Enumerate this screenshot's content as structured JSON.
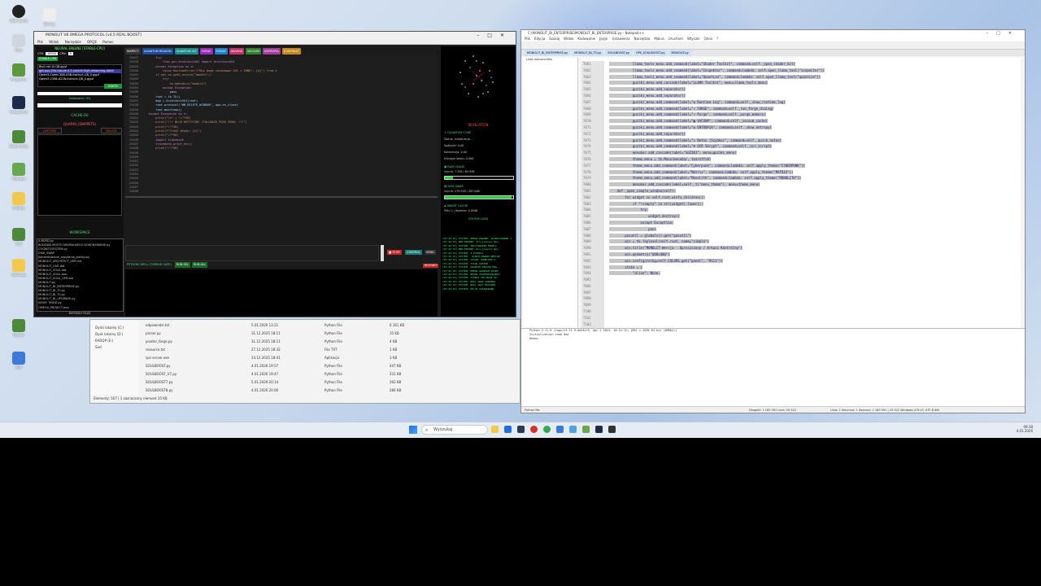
{
  "desktop": {
    "icons": [
      {
        "label": "OBS Studio"
      },
      {
        "label": "Ekrany"
      },
      {
        "label": "Kosz"
      },
      {
        "label": "Programy"
      },
      {
        "label": "Ustawienia"
      },
      {
        "label": "Dokumenty"
      },
      {
        "label": "Pobrane"
      },
      {
        "label": "Foldery"
      },
      {
        "label": "Sieć"
      },
      {
        "label": "Aplikacja"
      },
      {
        "label": "Python"
      },
      {
        "label": "Pliki"
      }
    ]
  },
  "explorer": {
    "nav": [
      "Dyski lokalny (C:)",
      "Dysk lokalny (D:)",
      "RADQP (E:)",
      "Sieć"
    ],
    "rows": [
      {
        "name": "odpowiedzi.txt",
        "date": "5.01.2026 13:21",
        "type": "Python File",
        "size": "6 161 KB"
      },
      {
        "name": "parser.py",
        "date": "31.12.2025 18:11",
        "type": "Python File",
        "size": "35 KB"
      },
      {
        "name": "pivator_forge.py",
        "date": "31.12.2025 18:11",
        "type": "Python File",
        "size": "4 KB"
      },
      {
        "name": "resource.txt",
        "date": "27.12.2025 18:32",
        "type": "File TXT",
        "size": "1 KB"
      },
      {
        "name": "spc-server.exe",
        "date": "14.12.2025 18:41",
        "type": "Aplikacja",
        "size": "3 KB"
      },
      {
        "name": "SOULBOOST.py",
        "date": "4.01.2026 19:57",
        "type": "Python File",
        "size": "447 KB"
      },
      {
        "name": "SOULBOOST_V7.py",
        "date": "4.01.2026 19:47",
        "type": "Python File",
        "size": "231 KB"
      },
      {
        "name": "SOULBOOST7.py",
        "date": "5.01.2026 20:14",
        "type": "Python File",
        "size": "262 KB"
      },
      {
        "name": "SOULBOOST8.py",
        "date": "4.01.2026 20:00",
        "type": "Python File",
        "size": "286 KB"
      }
    ],
    "status": "Elementy: 167 | 1 zaznaczony element 35 KB"
  },
  "app": {
    "title": "MONOLIT V8 OMEGA PROTOCOL [v4.5 REAL BOOST]",
    "menu": [
      "Plik",
      "Widok",
      "Narzędzia",
      "OPCJE",
      "Pomoc"
    ],
    "left": {
      "header": "NEURAL ENGINE [STABLE-CPU]",
      "ctx_label": "CTX:",
      "ctx_value": "16000",
      "cpu_label": "CPU:",
      "cpu_value": "8",
      "stable_btn": "STABLE CPU",
      "model_list": [
        "Bio2-vm-llr-Q8.gguf",
        "gpt-oss-20b-claude-4.5-sonnet-high-reasoning-distill",
        "Qwen3-Coder-30B-A3B-Instruct-Q8_0.gguf",
        "Qwen3-235B-A22B-Instruct-Q8_0.gguf"
      ],
      "ignite_btn": "IGNITE",
      "loaded_label": "Ładowanie: 0%",
      "cache_label": "CACHE.OU",
      "quarks_label": "QUARKS (SNIPPETS)",
      "capture_btn": "CAPTURE",
      "delete_btn": "DELETE",
      "workspace_label": "WORKSPACE",
      "files": [
        "A.BORD.py",
        "BUDOWA MOSTU NEURALNEGO DOKONYWANIE.py",
        "COGNITOSYSTEM.py",
        "DISK_SWAP",
        "Komentowanie_zapytania_jezdny.py",
        "MONOLIT_ARCHITECT_VER.md",
        "MONOLIT_LIVE.dat",
        "MONOLIT_SOUL.dat",
        "MONOLIT_SOUL.json",
        "MONOLIT_SOUL_VER.dat",
        "MONOLIT.py",
        "MONOLIT_BI_ENTERPRISE.py",
        "MONOLIT_BI_T0.py",
        "MONOLIT_BI_T0.py",
        "MONOLIT_BI_UPGRADE.py",
        "NOWY TEMAT.py",
        "OMEGA_PROJECT.json",
        "OPS_SOULBOOST.py"
      ],
      "refresh_btn": "REFRESH FILES"
    },
    "toolbar": [
      "INSPECT",
      "QUANTUM REASON",
      "QUANTUM VIZ",
      "PURGE",
      "FORGE",
      "AKASHA",
      "VACUUM",
      "ENTROPIA",
      "CONTRAST"
    ],
    "toolbar_colors": [
      "#333333",
      "#1c4a9b",
      "#1a8a8a",
      "#9b2cbf",
      "#1b7fc9",
      "#c0336e",
      "#2f7f2f",
      "#a33d9b",
      "#c08a1a"
    ],
    "editor": {
      "line_numbers": [
        "25427",
        "25428",
        "25429",
        "25430",
        "25431",
        "25432",
        "25433",
        "25434",
        "25435",
        "25436",
        "25437",
        "25438",
        "25439",
        "25440",
        "25441",
        "25442",
        "25443",
        "25444",
        "25445",
        "25446",
        "25447",
        "25448",
        "25449",
        "25450",
        "25451",
        "25452",
        "25453",
        "25454",
        "25455",
        "25456",
        "25457",
        "25458"
      ],
      "lines": [
        "",
        "        try:",
        "            from gui.ArchitectGUI import ArchitectGUI",
        "        except Exception as e:",
        "            raise RuntimeError(f\"Nie mogę załadować GUI z INNE/: {e}\") from e",
        "",
        "        if not os.path.exists(\"models\"):",
        "            try:",
        "                os.makedirs(\"models\")",
        "            except Exception:",
        "                pass",
        "",
        "        root = tk.Tk()",
        "        app = ArchitectGUI(root)",
        "        root.protocol(\"WM_DELETE_WINDOW\", app.on_close)",
        "        root.mainloop()",
        "    except Exception as e:",
        "        print(\"\\n\" + \"=\"*50)",
        "        print(\"!!! BŁĄD KRYTYCZNY (FALLBACK POZA VENV) !!!\")",
        "        print(\"=\"*50)",
        "        print(f\"Treść błędu: {e}\")",
        "        print(\"=\"*50)",
        "        import traceback",
        "        traceback.print_exc()",
        "        print(\"=\"*50)",
        "",
        "",
        "",
        "",
        "",
        "",
        ""
      ]
    },
    "stop_btn": "STOP",
    "control_btn": "CONTROL",
    "send_btn": "SEND",
    "restart_btn": "RESTART",
    "shell": [
      "PYTHON SHELL (THREAD SAFE)",
      "RUN SEL",
      "RUN ALL"
    ],
    "right": {
      "revelation": "REVELATION",
      "quantum_core": "QUANTUM CORE",
      "status": "Status: Inicjalizacja...",
      "spojnosc": "Spójność: 0.00",
      "koherencja": "Koherencja: 0.00",
      "entropia": "Entropia lokalu: 0.000",
      "ram_label": "RAM USAGE",
      "ram_text": "Użycie: 7.35B / 63.93B",
      "ram_fill": 0.12,
      "disk_label": "DISK SWAP",
      "disk_text": "Użycie: 279.91B / 287.00B",
      "disk_fill": 0.975,
      "cache_label": "SMART CACHE",
      "cache_text": "Pliki: 1 | Rozmiar: 0.094B",
      "log_title": "SYSTEM LOGS",
      "log": [
        "[07:42:33] SYSTEM: OMEGA ENGINE: ZAINICJOWANO 1",
        "[07:42:33] NEW ENGINE: Inicjowanie Neu",
        "[07:42:33] SYSTEM: INICJOWANIE MODELI",
        "[07:42:33] NEW ENGINE: Inicjowanie Neu",
        "[07:42:33] SYSTEM: 2 PYSPELL",
        "[07:42:33] SYSTEM: 'ZAINICJOWANO WERTUA'",
        "[07:42:33] SYSTEM: VISUAL KAMELEON V.",
        "[07:42:33] SYSTEM: TYTUŁ DOKTOR",
        "[07:42:33] SYSTEM: QUANTUM REASON ENG",
        "[07:42:33] SYSTEM: OMEGA QUANTUM ZAINI",
        "[07:42:33] SYSTEM: BUDOA ZINTERESOWANIA",
        "[07:42:33] SYSTEM: STABLE CPU MODE ZA",
        "[07:42:33] SYSTEM: REAL SWAP ZAWIERA",
        "[07:42:33] SYSTEM: REAL GOLF BUILDER",
        "[07:42:33] SYSTEM: OPCJE ZAŁADOWANE"
      ]
    }
  },
  "npp": {
    "title": "C:\\MONOLIT_BI_ENTERPRISE\\MONOLIT_BI_ENTERPRISE.py - Notepad++",
    "menu": [
      "Plik",
      "Edycja",
      "Szukaj",
      "Widok",
      "Kodowanie",
      "Język",
      "Ustawienia",
      "Narzędzia",
      "Makra",
      "Uruchom",
      "Wtyczki",
      "Okno",
      "?"
    ],
    "tabs": [
      "MONOLIT_BI_ENTERPRISE.py",
      "MONOLIT_BI_T0.py",
      "SOULBOOST.py",
      "OPS_SOULBOOST.py",
      "MONOLIT.py"
    ],
    "doclist_title": "Lista dokumentów",
    "line_numbers": [
      "7061",
      "7062",
      "7063",
      "7064",
      "7065",
      "7066",
      "7067",
      "7068",
      "7069",
      "7070",
      "7071",
      "7072",
      "7073",
      "7074",
      "7075",
      "7076",
      "7077",
      "7078",
      "7079",
      "7080",
      "7081",
      "7082",
      "7083",
      "7084",
      "7085",
      "7086",
      "7087",
      "7088",
      "7089",
      "7090",
      "7091",
      "7092",
      "7093",
      "7094",
      "7095",
      "7096",
      "7097",
      "7098",
      "7099",
      "7100",
      "7101",
      "7102",
      "7103",
      "7104",
      "7105",
      "7106"
    ],
    "lines": [
      "            llama_tools_menu.add_command(label=\"Shader Toolkit\", command=self._open_shader_kit)",
      "            llama_tools_menu.add_command(label=\"Inspektor\", command=lambda: self.open_llama_tool(\"inspector\"))",
      "            llama_tools_menu.add_command(label=\"Quantize\", command=lambda: self.open_llama_tool(\"quantize\"))",
      "            guziki_menu.add_cascade(label=\"LLAMA Toolkit\", menu=llama_tools_menu)",
      "",
      "            guziki_menu.add_separator()",
      "            guziki_menu.add_separator()",
      "            guziki_menu.add_command(label=\"⚙ Runtime Log\", command=self._show_runtime_log)",
      "            guziki_menu.add_command(label=\"⚡ FORGE\", command=self._run_forge_dialog)",
      "            guziki_menu.add_command(label=\"⚡ Purge\", command=self._purge_memory)",
      "            guziki_menu.add_command(label=\"▦ VACUUM\", command=self._vacuum_cache)",
      "            guziki_menu.add_command(label=\"⚙ ENTROPIA\", command=self._show_entropy)",
      "            guziki_menu.add_separator()",
      "            guziki_menu.add_command(label=\"✎ Notes (Szybko)\", command=self._quick_notes)",
      "            guziki_menu.add_command(label=\"⚑ OCR Skrypt\", command=self._ocr_script)",
      "",
      "            menubar.add_cascade(label=\"GUZIKI\", menu=guziki_menu)",
      "",
      "            theme_menu = tk.Menu(menubar, tearoff=0)",
      "            theme_menu.add_command(label=\"Cyberpunk\", command=lambda: self.apply_theme(\"CYBERPUNK\"))",
      "            theme_menu.add_command(label=\"Matrix\", command=lambda: self.apply_theme(\"MATRIX\"))",
      "            theme_menu.add_command(label=\"Monolith\", command=lambda: self.apply_theme(\"MONOLITH\"))",
      "",
      "            menubar.add_cascade(label=self._t(\"menu_theme\"), menu=theme_menu)",
      "",
      "    def _open_simple_window(self):",
      "        for widget in self.root.winfo_children():",
      "            if \"!simple\" in str(widget).lower():",
      "                try:",
      "                    widget.destroy()",
      "                except Exception:",
      "                    pass",
      "",
      "        pasutil = globals().get(\"pasutil\")",
      "        win = tk.Toplevel(self.root, name=\"simple\")",
      "        win.title(\"MONOLIT-Wersja - Uproszczony / Arkusz Kontrolny\")",
      "        win.geometry(\"600x400\")",
      "        win.configure(bg=self.COLORS.get(\"panel\", \"#111\"))",
      "",
      "        state = {",
      "            \"alive\": None,",
      "",
      "",
      "",
      "",
      ""
    ],
    "console": [
      "Python 3.11.9 (tags/v3.11.9:de54cf5, Apr 2 2024, 10:12:12) [MSC v.1938 64 bit (AMD64)]",
      "Initialization took 0ms",
      "Ready."
    ],
    "status_left": "Python file",
    "status_mid": "Długość: 1 183 091   Linie: 25 522",
    "status_right": "Linia: 1   Kolumna: 1   Zaznacz: 1 183 091 | 25 522   Windows (CR LF)   UTF-8   INS"
  },
  "taskbar": {
    "search_placeholder": "Wyszukaj",
    "time": "09:38",
    "date": "4.01.2026"
  }
}
